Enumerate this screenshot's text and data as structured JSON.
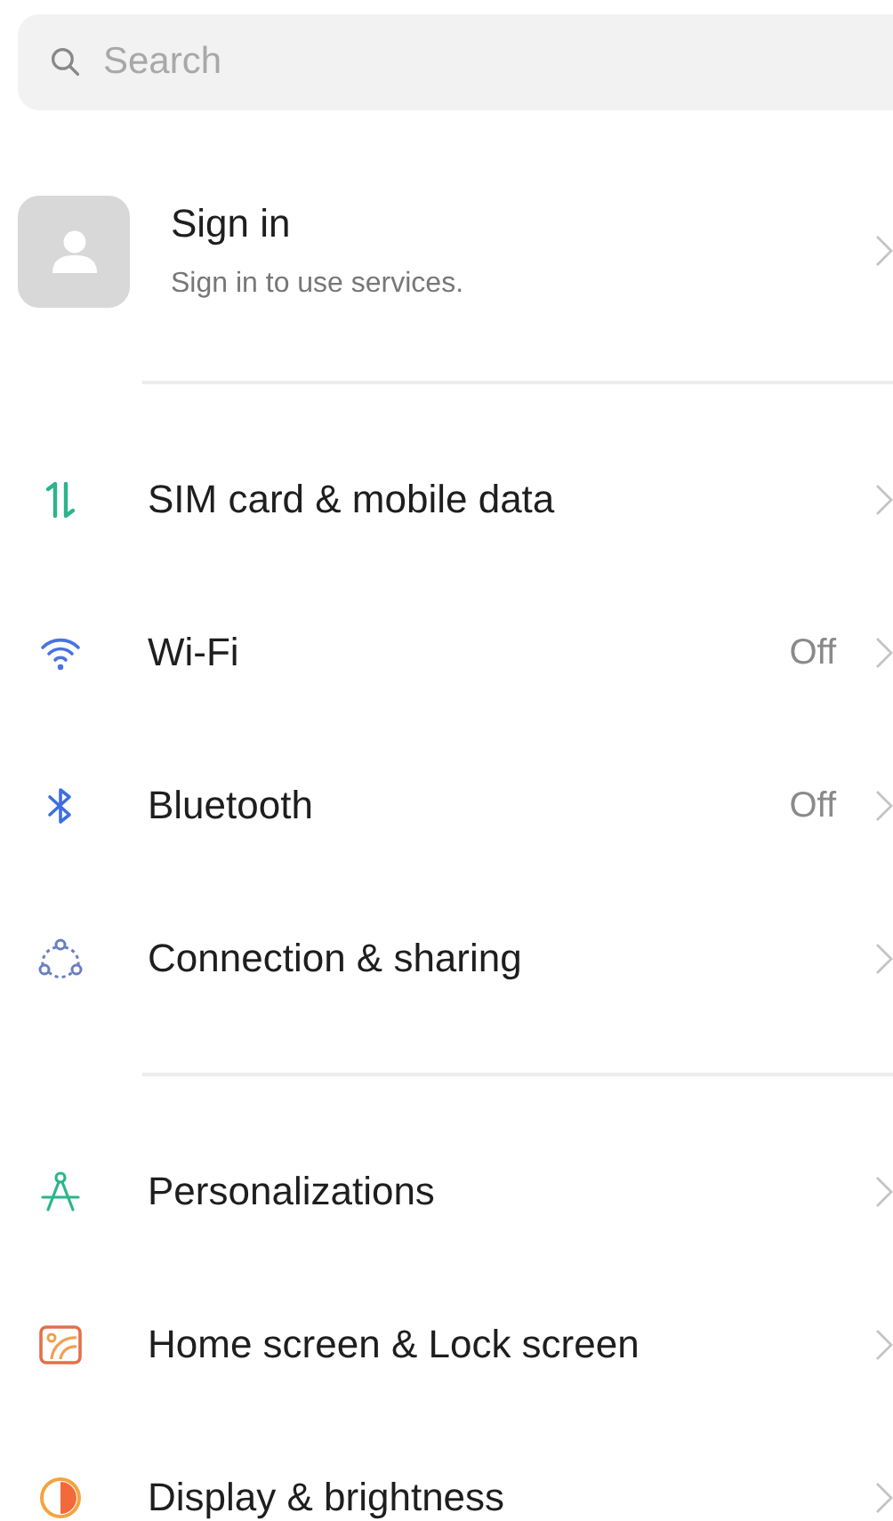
{
  "search": {
    "placeholder": "Search"
  },
  "account": {
    "title": "Sign in",
    "subtitle": "Sign in to use services."
  },
  "sections": [
    {
      "items": [
        {
          "label": "SIM card & mobile data"
        },
        {
          "label": "Wi-Fi",
          "value": "Off"
        },
        {
          "label": "Bluetooth",
          "value": "Off"
        },
        {
          "label": "Connection & sharing"
        }
      ]
    },
    {
      "items": [
        {
          "label": "Personalizations"
        },
        {
          "label": "Home screen & Lock screen"
        },
        {
          "label": "Display & brightness"
        }
      ]
    }
  ]
}
